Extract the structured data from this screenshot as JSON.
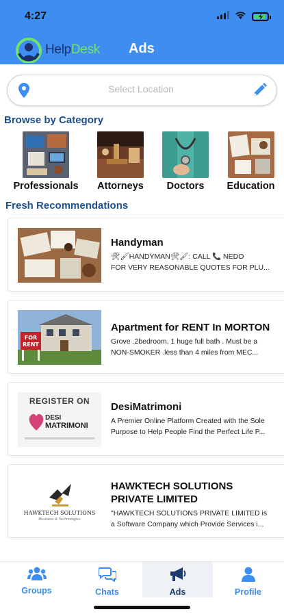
{
  "status_bar": {
    "time": "4:27"
  },
  "header": {
    "brand_help": "Help",
    "brand_desk": "Desk",
    "title": "Ads"
  },
  "location": {
    "placeholder": "Select Location"
  },
  "browse": {
    "title": "Browse by Category",
    "categories": [
      {
        "label": "Professionals"
      },
      {
        "label": "Attorneys"
      },
      {
        "label": "Doctors"
      },
      {
        "label": "Education"
      }
    ]
  },
  "fresh": {
    "title": "Fresh Recommendations",
    "ads": [
      {
        "title": "Handyman",
        "line1": "🛠🖌HANDYMAN🛠🖌: CALL 📞 NEDO",
        "line2": "FOR VERY REASONABLE QUOTES FOR  PLU..."
      },
      {
        "title": "Apartment for RENT In MORTON",
        "line1": "Grove .2bedroom, 1 huge full bath . Must be a",
        "line2": "NON-SMOKER .less than 4 miles from MEC..."
      },
      {
        "title": "DesiMatrimoni",
        "line1": "A Premier Online Platform Created with the Sole",
        "line2": "Purpose to Help People Find the Perfect Life P...",
        "thumb_heading": "REGISTER ON",
        "thumb_brand": "DESI",
        "thumb_brand2": "MATRIMONI"
      },
      {
        "title_line1": "HAWKTECH SOLUTIONS",
        "title_line2": "PRIVATE LIMITED",
        "line1": "\"HAWKTECH SOLUTIONS PRIVATE LIMITED is",
        "line2": "a Software Company which Provide Services i...",
        "thumb_brand": "HAWKTECH SOLUTIONS",
        "thumb_tag": "Business & Technologies"
      }
    ]
  },
  "tabs": [
    {
      "label": "Groups",
      "icon": "groups-icon"
    },
    {
      "label": "Chats",
      "icon": "chats-icon"
    },
    {
      "label": "Ads",
      "icon": "megaphone-icon",
      "active": true
    },
    {
      "label": "Profile",
      "icon": "profile-icon"
    }
  ],
  "colors": {
    "header_blue": "#3d8ef0",
    "section_title": "#1d4f8f",
    "active_tab_bg": "#eef1f5"
  }
}
